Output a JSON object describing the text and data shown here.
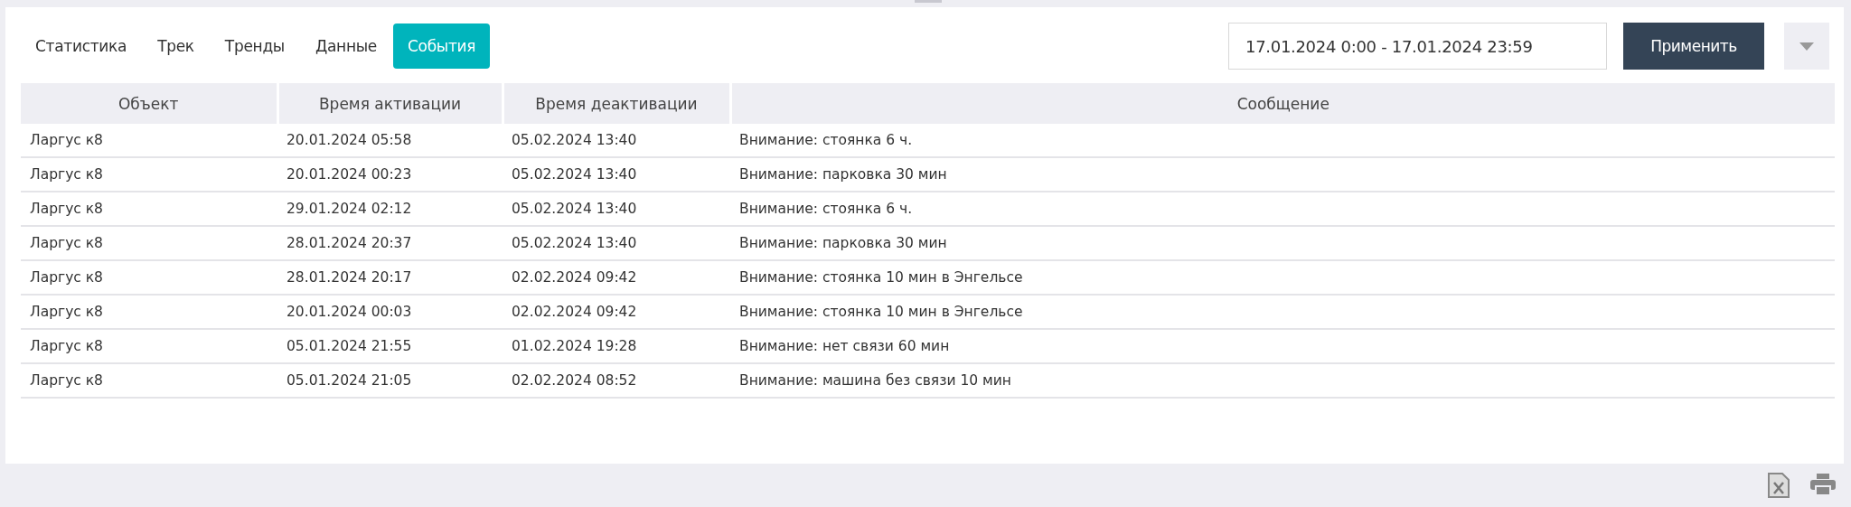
{
  "tabs": [
    {
      "label": "Статистика",
      "selected": false
    },
    {
      "label": "Трек",
      "selected": false
    },
    {
      "label": "Тренды",
      "selected": false
    },
    {
      "label": "Данные",
      "selected": false
    },
    {
      "label": "События",
      "selected": true
    }
  ],
  "date_range": {
    "value": "17.01.2024 0:00 - 17.01.2024 23:59"
  },
  "apply_button": "Применить",
  "table": {
    "columns": [
      "Объект",
      "Время активации",
      "Время деактивации",
      "Сообщение"
    ],
    "rows": [
      [
        "Ларгус к8",
        "20.01.2024 05:58",
        "05.02.2024 13:40",
        "Внимание: стоянка 6 ч."
      ],
      [
        "Ларгус к8",
        "20.01.2024 00:23",
        "05.02.2024 13:40",
        "Внимание: парковка 30 мин"
      ],
      [
        "Ларгус к8",
        "29.01.2024 02:12",
        "05.02.2024 13:40",
        "Внимание: стоянка 6 ч."
      ],
      [
        "Ларгус к8",
        "28.01.2024 20:37",
        "05.02.2024 13:40",
        "Внимание: парковка 30 мин"
      ],
      [
        "Ларгус к8",
        "28.01.2024 20:17",
        "02.02.2024 09:42",
        "Внимание: стоянка 10 мин в Энгельсе"
      ],
      [
        "Ларгус к8",
        "20.01.2024 00:03",
        "02.02.2024 09:42",
        "Внимание: стоянка 10 мин в Энгельсе"
      ],
      [
        "Ларгус к8",
        "05.01.2024 21:55",
        "01.02.2024 19:28",
        "Внимание: нет связи 60 мин"
      ],
      [
        "Ларгус к8",
        "05.01.2024 21:05",
        "02.02.2024 08:52",
        "Внимание: машина без связи 10 мин"
      ]
    ]
  }
}
